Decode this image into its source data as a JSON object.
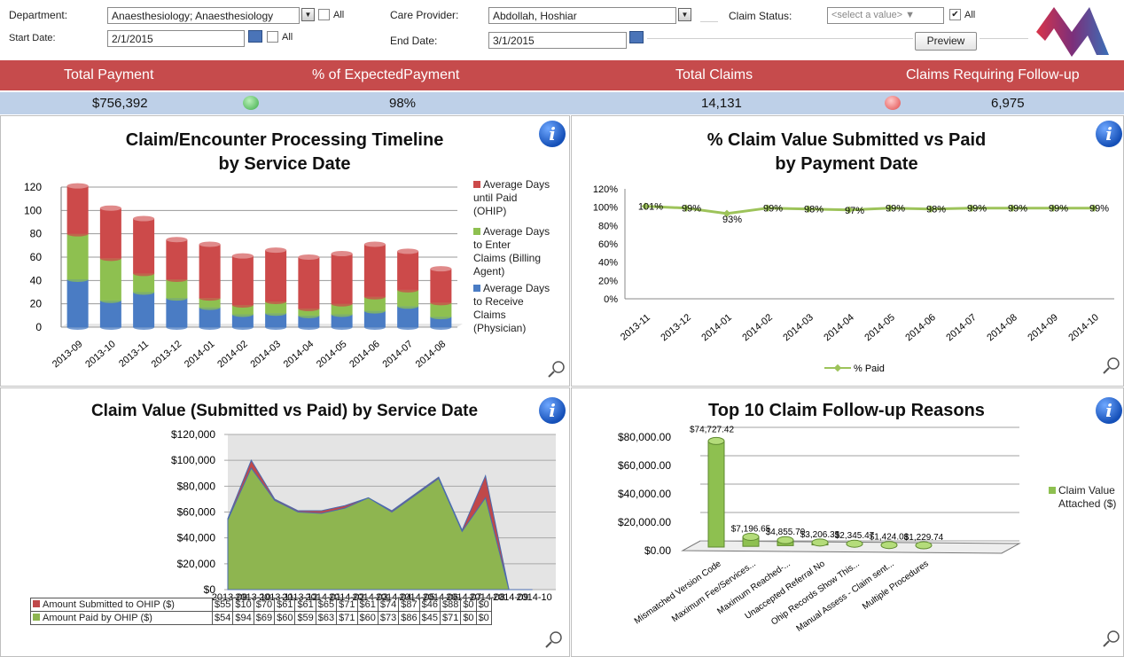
{
  "filters": {
    "department_label": "Department:",
    "department_value": "Anaesthesiology; Anaesthesiology",
    "all_label": "All",
    "care_provider_label": "Care Provider:",
    "care_provider_value": "Abdollah, Hoshiar",
    "claim_status_label": "Claim Status:",
    "claim_status_value": "<select a value>",
    "start_date_label": "Start Date:",
    "start_date_value": "2/1/2015",
    "end_date_label": "End Date:",
    "end_date_value": "3/1/2015",
    "preview_label": "Preview"
  },
  "kpis": {
    "total_payment_label": "Total Payment",
    "total_payment_value": "$756,392",
    "pct_expected_label": "% of ExpectedPayment",
    "pct_expected_value": "98%",
    "total_claims_label": "Total Claims",
    "total_claims_value": "14,131",
    "followup_label": "Claims Requiring Follow-up",
    "followup_value": "6,975",
    "colors": {
      "good": "#5cc46a",
      "bad": "#e86464",
      "header": "#c64b4c",
      "row": "#bed0e8"
    }
  },
  "info_glyph": "i",
  "chart_data": [
    {
      "type": "bar",
      "title": "Claim/Encounter  Processing Timeline by Service Date",
      "categories": [
        "2013-09",
        "2013-10",
        "2013-11",
        "2013-12",
        "2014-01",
        "2014-02",
        "2014-03",
        "2014-04",
        "2014-05",
        "2014-06",
        "2014-07",
        "2014-08"
      ],
      "stacked": true,
      "ylim": [
        0,
        120
      ],
      "yticks": [
        0,
        20,
        40,
        60,
        80,
        100,
        120
      ],
      "series": [
        {
          "name": "Average Days to Receive Claims (Physician)",
          "color": "#4a7cc4",
          "values": [
            41,
            23,
            30,
            25,
            17,
            11,
            12,
            10,
            11,
            14,
            18,
            9
          ]
        },
        {
          "name": "Average Days to Enter Claims (Billing Agent)",
          "color": "#8ec050",
          "values": [
            39,
            36,
            16,
            16,
            8,
            8,
            10,
            6,
            9,
            12,
            14,
            12
          ]
        },
        {
          "name": "Average Days until Paid (OHIP)",
          "color": "#cc4a4a",
          "values": [
            41,
            43,
            47,
            34,
            46,
            42,
            44,
            44,
            43,
            45,
            33,
            29
          ]
        }
      ],
      "legend_lines": [
        [
          "Average Days",
          "until Paid",
          "(OHIP)"
        ],
        [
          "Average Days",
          "to Enter",
          "Claims (Billing",
          "Agent)"
        ],
        [
          "Average Days",
          "to Receive",
          "Claims",
          "(Physician)"
        ]
      ],
      "legend_position": "right"
    },
    {
      "type": "line",
      "title": "% Claim Value Submitted vs Paid by Payment Date",
      "categories": [
        "2013-11",
        "2013-12",
        "2014-01",
        "2014-02",
        "2014-03",
        "2014-04",
        "2014-05",
        "2014-06",
        "2014-07",
        "2014-08",
        "2014-09",
        "2014-10"
      ],
      "series": [
        {
          "name": "% Paid",
          "color": "#9dc35a",
          "values": [
            101,
            99,
            93,
            99,
            98,
            97,
            99,
            98,
            99,
            99,
            99,
            99
          ],
          "labels": [
            "101%",
            "99%",
            "93%",
            "99%",
            "98%",
            "97%",
            "99%",
            "98%",
            "99%",
            "99%",
            "99%",
            "99%"
          ]
        }
      ],
      "ylim": [
        0,
        120
      ],
      "yticks": [
        "0%",
        "20%",
        "40%",
        "60%",
        "80%",
        "100%",
        "120%"
      ],
      "legend_position": "bottom"
    },
    {
      "type": "area",
      "title": "Claim Value (Submitted vs Paid) by Service Date",
      "categories": [
        "2013-09",
        "2013-10",
        "2013-11",
        "2013-12",
        "2014-01",
        "2014-02",
        "2014-03",
        "2014-04",
        "2014-05",
        "2014-06",
        "2014-07",
        "2014-08",
        "2014-09",
        "2014-10"
      ],
      "ylim": [
        0,
        120000
      ],
      "yticks": [
        "$0",
        "$20,000",
        "$40,000",
        "$60,000",
        "$80,000",
        "$100,000",
        "$120,000"
      ],
      "series": [
        {
          "name": "Amount Submitted  to OHIP ($)",
          "color": "#c0484a",
          "values": [
            55,
            100,
            70,
            61,
            61,
            65,
            71,
            61,
            74,
            87,
            46,
            88,
            0,
            0
          ],
          "labels": [
            "$55",
            "$10",
            "$70",
            "$61",
            "$61",
            "$65",
            "$71",
            "$61",
            "$74",
            "$87",
            "$46",
            "$88",
            "$0",
            "$0"
          ]
        },
        {
          "name": "Amount Paid by OHIP ($)",
          "color": "#8eb550",
          "values": [
            54,
            94,
            69,
            60,
            59,
            63,
            71,
            60,
            73,
            86,
            45,
            71,
            0,
            0
          ],
          "labels": [
            "$54",
            "$94",
            "$69",
            "$60",
            "$59",
            "$63",
            "$71",
            "$60",
            "$73",
            "$86",
            "$45",
            "$71",
            "$0",
            "$0"
          ]
        }
      ],
      "grid": true,
      "legend_position": "bottom-table"
    },
    {
      "type": "bar",
      "title": "Top 10 Claim Follow-up Reasons",
      "categories": [
        "Mismatched Version Code",
        "Maximum Fee/Services...",
        "Maximum Reached-...",
        "Unaccepted Referral No",
        "Ohip Records Show This...",
        "Manual Assess - Claim sent...",
        "Multiple Procedures"
      ],
      "series": [
        {
          "name": "Claim Value Attached ($)",
          "color": "#8ec050",
          "values": [
            74727.42,
            7196.65,
            4855.7,
            3206.35,
            2345.47,
            1424.08,
            1229.74
          ],
          "labels": [
            "$74,727.42",
            "$7,196.65",
            "$4,855.70",
            "$3,206.35",
            "$2,345.47",
            "$1,424.08",
            "$1,229.74"
          ]
        }
      ],
      "ylim": [
        0,
        80000
      ],
      "yticks": [
        "$0.00",
        "$20,000.00",
        "$40,000.00",
        "$60,000.00",
        "$80,000.00"
      ],
      "legend_lines": [
        "Claim Value",
        "Attached ($)"
      ],
      "legend_position": "right"
    }
  ]
}
